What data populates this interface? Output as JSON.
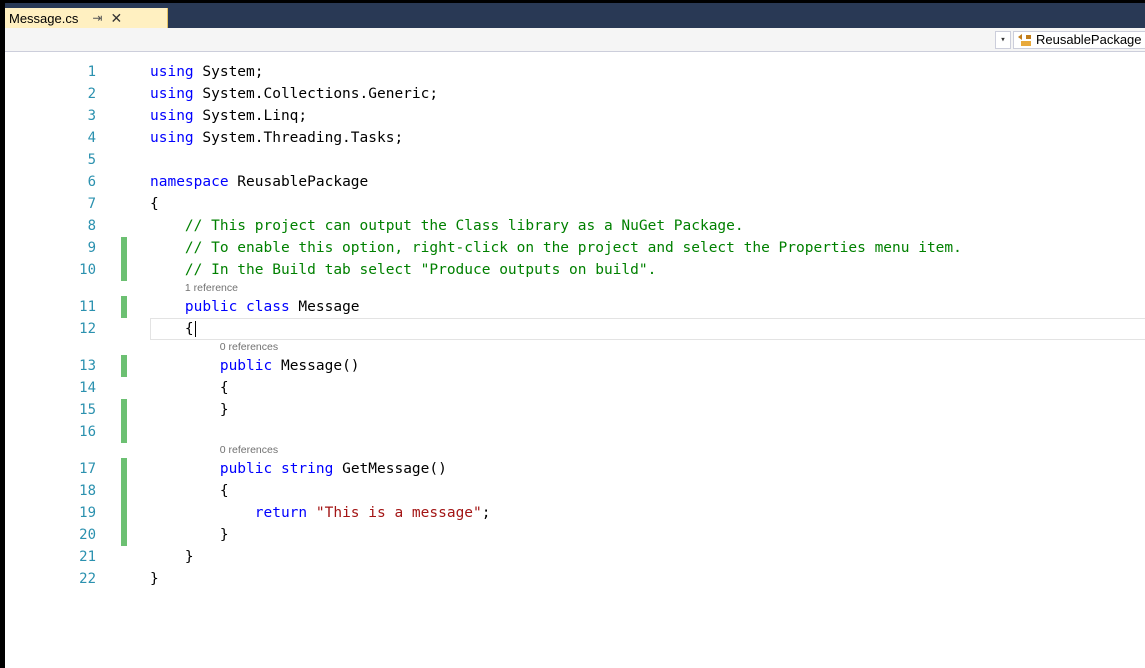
{
  "tab": {
    "title": "Message.cs",
    "pin_glyph": "⇥",
    "close_glyph": "✕"
  },
  "navbar": {
    "member": "ReusablePackage",
    "dropdown_glyph": "▾"
  },
  "colors": {
    "keyword": "#0000ff",
    "comment": "#008000",
    "string": "#a31515",
    "line_number": "#2b91af",
    "change_marker": "#6cc072",
    "tab_bg": "#fff0c1"
  },
  "lines": [
    {
      "n": "1",
      "parts": [
        {
          "t": "using",
          "c": "kw"
        },
        {
          "t": " System;"
        }
      ]
    },
    {
      "n": "2",
      "parts": [
        {
          "t": "using",
          "c": "kw"
        },
        {
          "t": " System.Collections.Generic;"
        }
      ]
    },
    {
      "n": "3",
      "parts": [
        {
          "t": "using",
          "c": "kw"
        },
        {
          "t": " System.Linq;"
        }
      ]
    },
    {
      "n": "4",
      "parts": [
        {
          "t": "using",
          "c": "kw"
        },
        {
          "t": " System.Threading.Tasks;"
        }
      ]
    },
    {
      "n": "5",
      "parts": []
    },
    {
      "n": "6",
      "parts": [
        {
          "t": "namespace",
          "c": "kw"
        },
        {
          "t": " ReusablePackage"
        }
      ]
    },
    {
      "n": "7",
      "parts": [
        {
          "t": "{"
        }
      ]
    },
    {
      "n": "8",
      "parts": [
        {
          "t": "    "
        },
        {
          "t": "// This project can output the Class library as a NuGet Package.",
          "c": "cm"
        }
      ]
    },
    {
      "n": "9",
      "changed": true,
      "parts": [
        {
          "t": "    "
        },
        {
          "t": "// To enable this option, right-click on the project and select the Properties menu item.",
          "c": "cm"
        }
      ]
    },
    {
      "n": "10",
      "changed": true,
      "parts": [
        {
          "t": "    "
        },
        {
          "t": "// In the Build tab select \"Produce outputs on build\".",
          "c": "cm"
        }
      ]
    },
    {
      "lens": "1 reference",
      "indent": 4
    },
    {
      "n": "11",
      "changed": true,
      "parts": [
        {
          "t": "    "
        },
        {
          "t": "public",
          "c": "kw"
        },
        {
          "t": " "
        },
        {
          "t": "class",
          "c": "kw"
        },
        {
          "t": " Message"
        }
      ]
    },
    {
      "n": "12",
      "current": true,
      "parts": [
        {
          "t": "    {"
        }
      ]
    },
    {
      "lens": "0 references",
      "indent": 8
    },
    {
      "n": "13",
      "changed": true,
      "parts": [
        {
          "t": "        "
        },
        {
          "t": "public",
          "c": "kw"
        },
        {
          "t": " Message()"
        }
      ]
    },
    {
      "n": "14",
      "parts": [
        {
          "t": "        {"
        }
      ]
    },
    {
      "n": "15",
      "changed": true,
      "parts": [
        {
          "t": "        }"
        }
      ]
    },
    {
      "n": "16",
      "changed": true,
      "parts": []
    },
    {
      "lens": "0 references",
      "indent": 8
    },
    {
      "n": "17",
      "changed": true,
      "parts": [
        {
          "t": "        "
        },
        {
          "t": "public",
          "c": "kw"
        },
        {
          "t": " "
        },
        {
          "t": "string",
          "c": "kw"
        },
        {
          "t": " GetMessage()"
        }
      ]
    },
    {
      "n": "18",
      "changed": true,
      "parts": [
        {
          "t": "        {"
        }
      ]
    },
    {
      "n": "19",
      "changed": true,
      "parts": [
        {
          "t": "            "
        },
        {
          "t": "return",
          "c": "kw"
        },
        {
          "t": " "
        },
        {
          "t": "\"This is a message\"",
          "c": "str"
        },
        {
          "t": ";"
        }
      ]
    },
    {
      "n": "20",
      "changed": true,
      "parts": [
        {
          "t": "        }"
        }
      ]
    },
    {
      "n": "21",
      "parts": [
        {
          "t": "    }"
        }
      ]
    },
    {
      "n": "22",
      "parts": [
        {
          "t": "}"
        }
      ]
    }
  ]
}
